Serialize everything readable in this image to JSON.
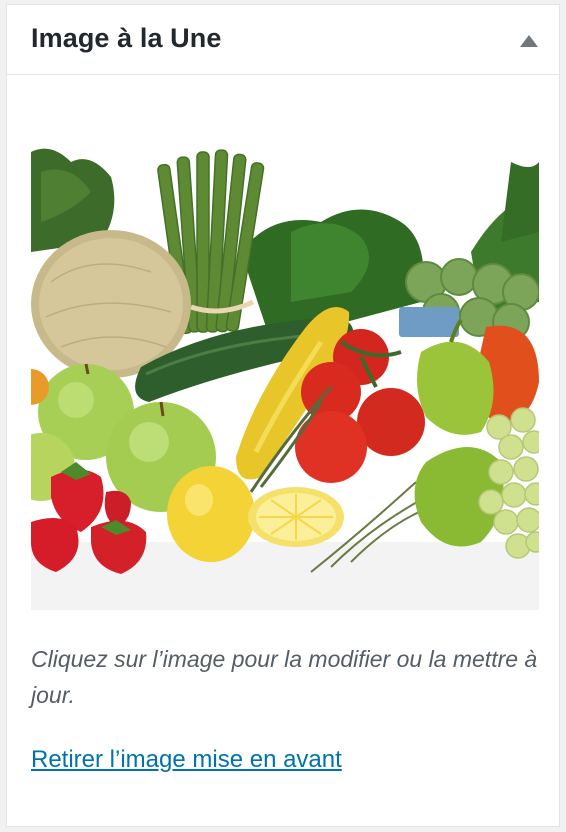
{
  "panel": {
    "title": "Image à la Une",
    "toggle_icon": "triangle-up-icon"
  },
  "featured_image": {
    "subject": "assorted fruits and vegetables"
  },
  "help_text": "Cliquez sur l’image pour la modifier ou la mettre à jour.",
  "remove_link_label": "Retirer l’image mise en avant",
  "colors": {
    "link": "#0073aa",
    "title": "#23282d",
    "help": "#555d66",
    "border": "#e2e4e7"
  }
}
